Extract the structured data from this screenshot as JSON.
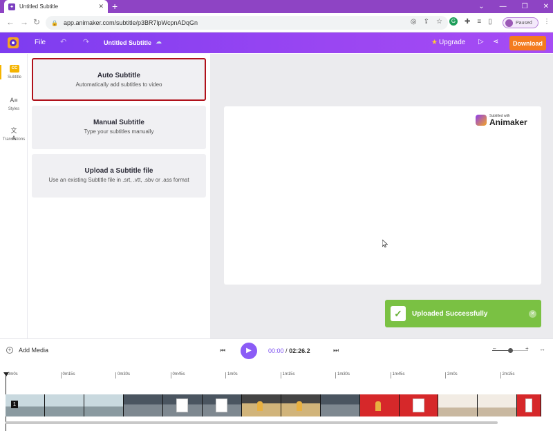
{
  "browser": {
    "tab_title": "Untitled Subtitle",
    "new_tab": "+",
    "url": "app.animaker.com/subtitle/p3BR7lpWcpnADqGn",
    "profile_status": "Paused"
  },
  "header": {
    "file_label": "File",
    "project_title": "Untitled Subtitle",
    "upgrade_label": "Upgrade",
    "download_label": "Download",
    "accent_color": "#8b3cf0",
    "download_color": "#f47b1f"
  },
  "rail": {
    "items": [
      {
        "label": "Subtitle",
        "icon": "cc-icon"
      },
      {
        "label": "Styles",
        "icon": "text-style-icon"
      },
      {
        "label": "Translations",
        "icon": "translate-icon"
      }
    ]
  },
  "options": {
    "auto": {
      "title": "Auto Subtitle",
      "subtitle": "Automatically add subtitles to video"
    },
    "manual": {
      "title": "Manual Subtitle",
      "subtitle": "Type your subtitles manually"
    },
    "upload": {
      "title": "Upload a Subtitle file",
      "subtitle": "Use an existing Subtitle file in .srt, .vtt, .sbv or .ass format"
    }
  },
  "watermark": {
    "line1": "Subtitled with",
    "line2": "Animaker"
  },
  "toast": {
    "message": "Uploaded Successfully",
    "color": "#7ac143"
  },
  "playback": {
    "add_media_label": "Add Media",
    "current_time": "00:00",
    "separator": "/",
    "total_time": "02:26.2",
    "zoom_level": 0.5
  },
  "timeline": {
    "ticks": [
      "0m0s",
      "0m15s",
      "0m30s",
      "0m45s",
      "1m0s",
      "1m15s",
      "1m30s",
      "1m45s",
      "2m0s",
      "2m15s"
    ],
    "scene_number": "1"
  }
}
